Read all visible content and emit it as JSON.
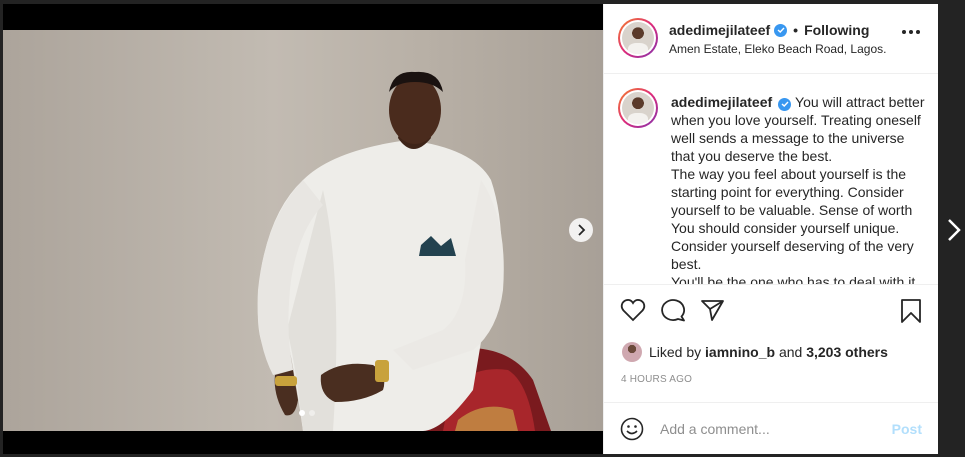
{
  "post": {
    "username": "adedimejilateef",
    "follow_status": "Following",
    "separator": "•",
    "location": "Amen Estate, Eleko Beach Road, Lagos.",
    "caption_lines": [
      "You will attract better when you love yourself. Treating oneself well sends a message to the universe that you deserve the best.",
      "The way you feel about yourself is the starting point for everything. Consider yourself to be valuable. Sense of worth You should consider yourself unique. Consider yourself deserving of the very best.",
      "You'll be the one who has to deal with it"
    ],
    "liked_by_prefix": "Liked by",
    "liked_by_user": "iamnino_b",
    "liked_by_connector": "and",
    "liked_by_others": "3,203 others",
    "timestamp": "4 HOURS AGO"
  },
  "comment": {
    "placeholder": "Add a comment...",
    "post_label": "Post"
  },
  "carousel": {
    "total": 2,
    "active_index": 0
  },
  "colors": {
    "verified": "#3897f0",
    "post_disabled": "#b2dffc",
    "text": "#262626",
    "muted": "#8e8e8e"
  },
  "icons": {
    "more": "more-options-icon",
    "like": "heart-icon",
    "comment": "comment-icon",
    "share": "share-icon",
    "save": "bookmark-icon",
    "emoji": "emoji-icon",
    "next": "chevron-right-icon"
  }
}
